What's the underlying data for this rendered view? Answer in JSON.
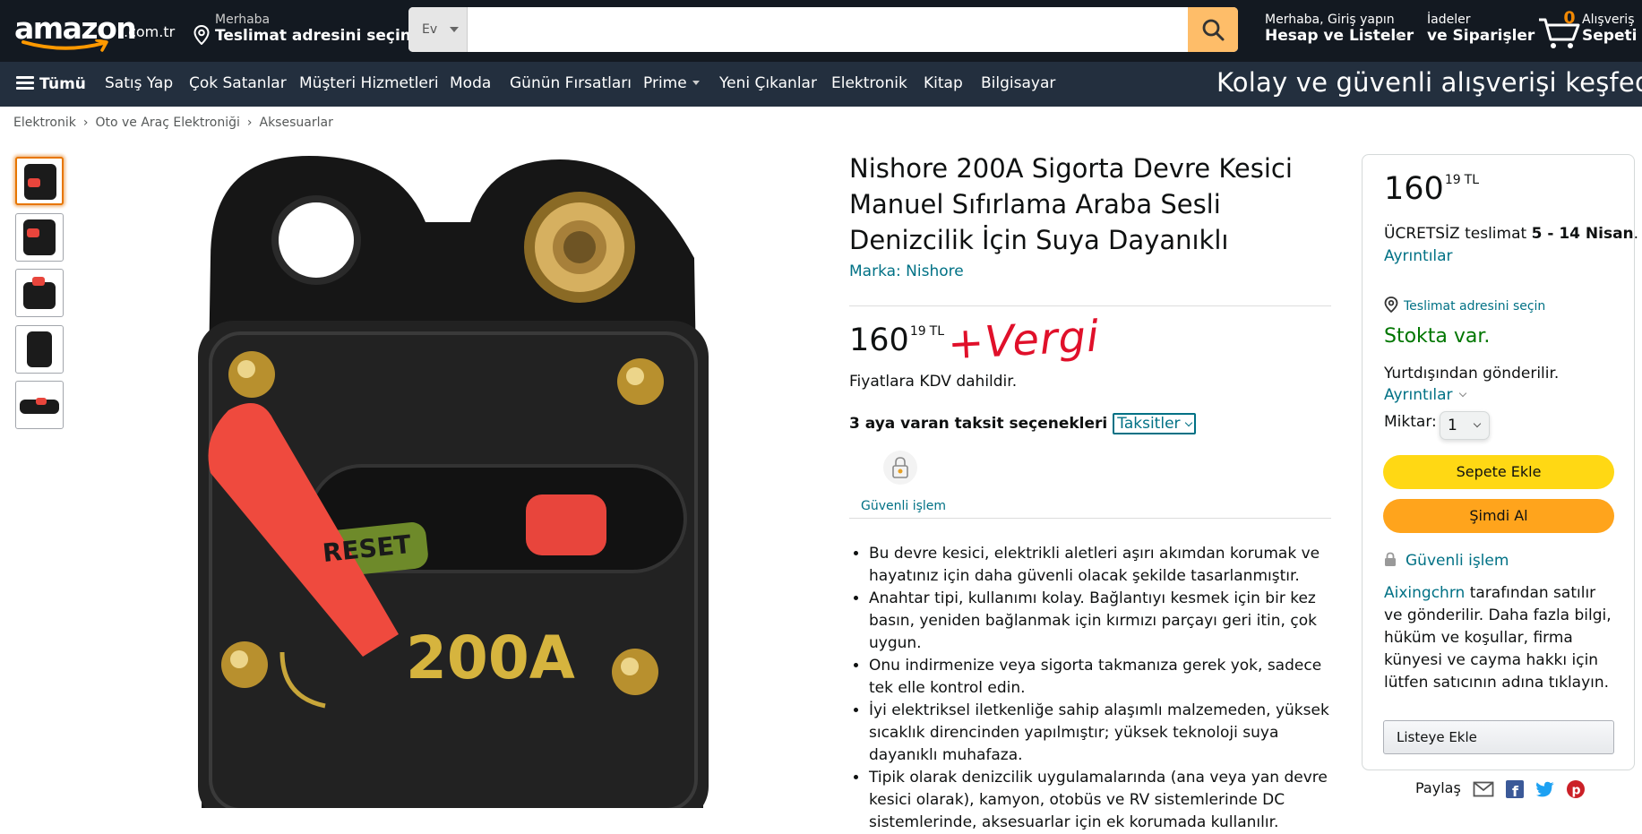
{
  "header": {
    "logo_text": "amazon",
    "logo_tld": ".com.tr",
    "location_line1": "Merhaba",
    "location_line2": "Teslimat adresini seçin",
    "search_category": "Ev",
    "search_placeholder": "",
    "account_line1": "Merhaba, Giriş yapın",
    "account_line2": "Hesap ve Listeler",
    "orders_line1": "İadeler",
    "orders_line2": "ve Siparişler",
    "cart_count": "0",
    "cart_line1": "Alışveriş",
    "cart_line2": "Sepeti"
  },
  "subnav": {
    "all_label": "Tümü",
    "items": [
      "Satış Yap",
      "Çok Satanlar",
      "Müşteri Hizmetleri",
      "Moda",
      "Günün Fırsatları",
      "Prime",
      "Yeni Çıkanlar",
      "Elektronik",
      "Kitap",
      "Bilgisayar"
    ],
    "promo": "Kolay ve güvenli alışverişi keşfedin ❯"
  },
  "breadcrumb": [
    "Elektronik",
    "Oto ve Araç Elektroniği",
    "Aksesuarlar"
  ],
  "product": {
    "title": "Nishore 200A Sigorta Devre Kesici Manuel Sıfırlama Araba Sesli Denizcilik İçin Suya Dayanıklı",
    "brand": "Marka: Nishore",
    "price_whole": "160",
    "price_fraction": "19",
    "price_currency": "TL",
    "annotation": "+Vergi",
    "vat_note": "Fiyatlara KDV dahildir.",
    "installment_text": "3 aya varan taksit seçenekleri",
    "installment_link": "Taksitler",
    "secure_label": "Güvenli işlem",
    "image_label_reset": "RESET",
    "image_label_amp": "200A",
    "bullets": [
      "Bu devre kesici, elektrikli aletleri aşırı akımdan korumak ve hayatınız için daha güvenli olacak şekilde tasarlanmıştır.",
      "Anahtar tipi, kullanımı kolay. Bağlantıyı kesmek için bir kez basın, yeniden bağlanmak için kırmızı parçayı geri itin, çok uygun.",
      "Onu indirmenize veya sigorta takmanıza gerek yok, sadece tek elle kontrol edin.",
      "İyi elektriksel iletkenliğe sahip alaşımlı malzemeden, yüksek sıcaklık direncinden yapılmıştır; yüksek teknoloji suya dayanıklı muhafaza.",
      "Tipik olarak denizcilik uygulamalarında (ana veya yan devre kesici olarak), kamyon, otobüs ve RV sistemlerinde DC sistemlerinde, aksesuarlar için ek korumada kullanılır."
    ]
  },
  "buybox": {
    "price_whole": "160",
    "price_fraction": "19",
    "price_currency": "TL",
    "shipping_prefix": "ÜCRETSİZ teslimat ",
    "shipping_dates": "5 - 14 Nisan",
    "shipping_suffix": ".",
    "details_link": "Ayrıntılar",
    "location_link": "Teslimat adresini seçin",
    "stock": "Stokta var.",
    "abroad": "Yurtdışından gönderilir.",
    "details_link2": "Ayrıntılar",
    "qty_label": "Miktar:",
    "qty_value": "1",
    "add_to_cart": "Sepete Ekle",
    "buy_now": "Şimdi Al",
    "secure": "Güvenli işlem",
    "seller_name": "Aixingchrn",
    "seller_text": " tarafından satılır ve gönderilir. Daha fazla bilgi, hüküm ve koşullar, firma künyesi ve cayma hakkı için lütfen satıcının adına tıklayın.",
    "add_to_list": "Listeye Ekle"
  },
  "share": {
    "label": "Paylaş"
  },
  "colors": {
    "nav_bg": "#131921",
    "subnav_bg": "#232f3e",
    "link": "#007185",
    "in_stock": "#007600",
    "cart_button": "#ffd814",
    "buy_button": "#ffa41c",
    "annotation_red": "#e0102a"
  }
}
